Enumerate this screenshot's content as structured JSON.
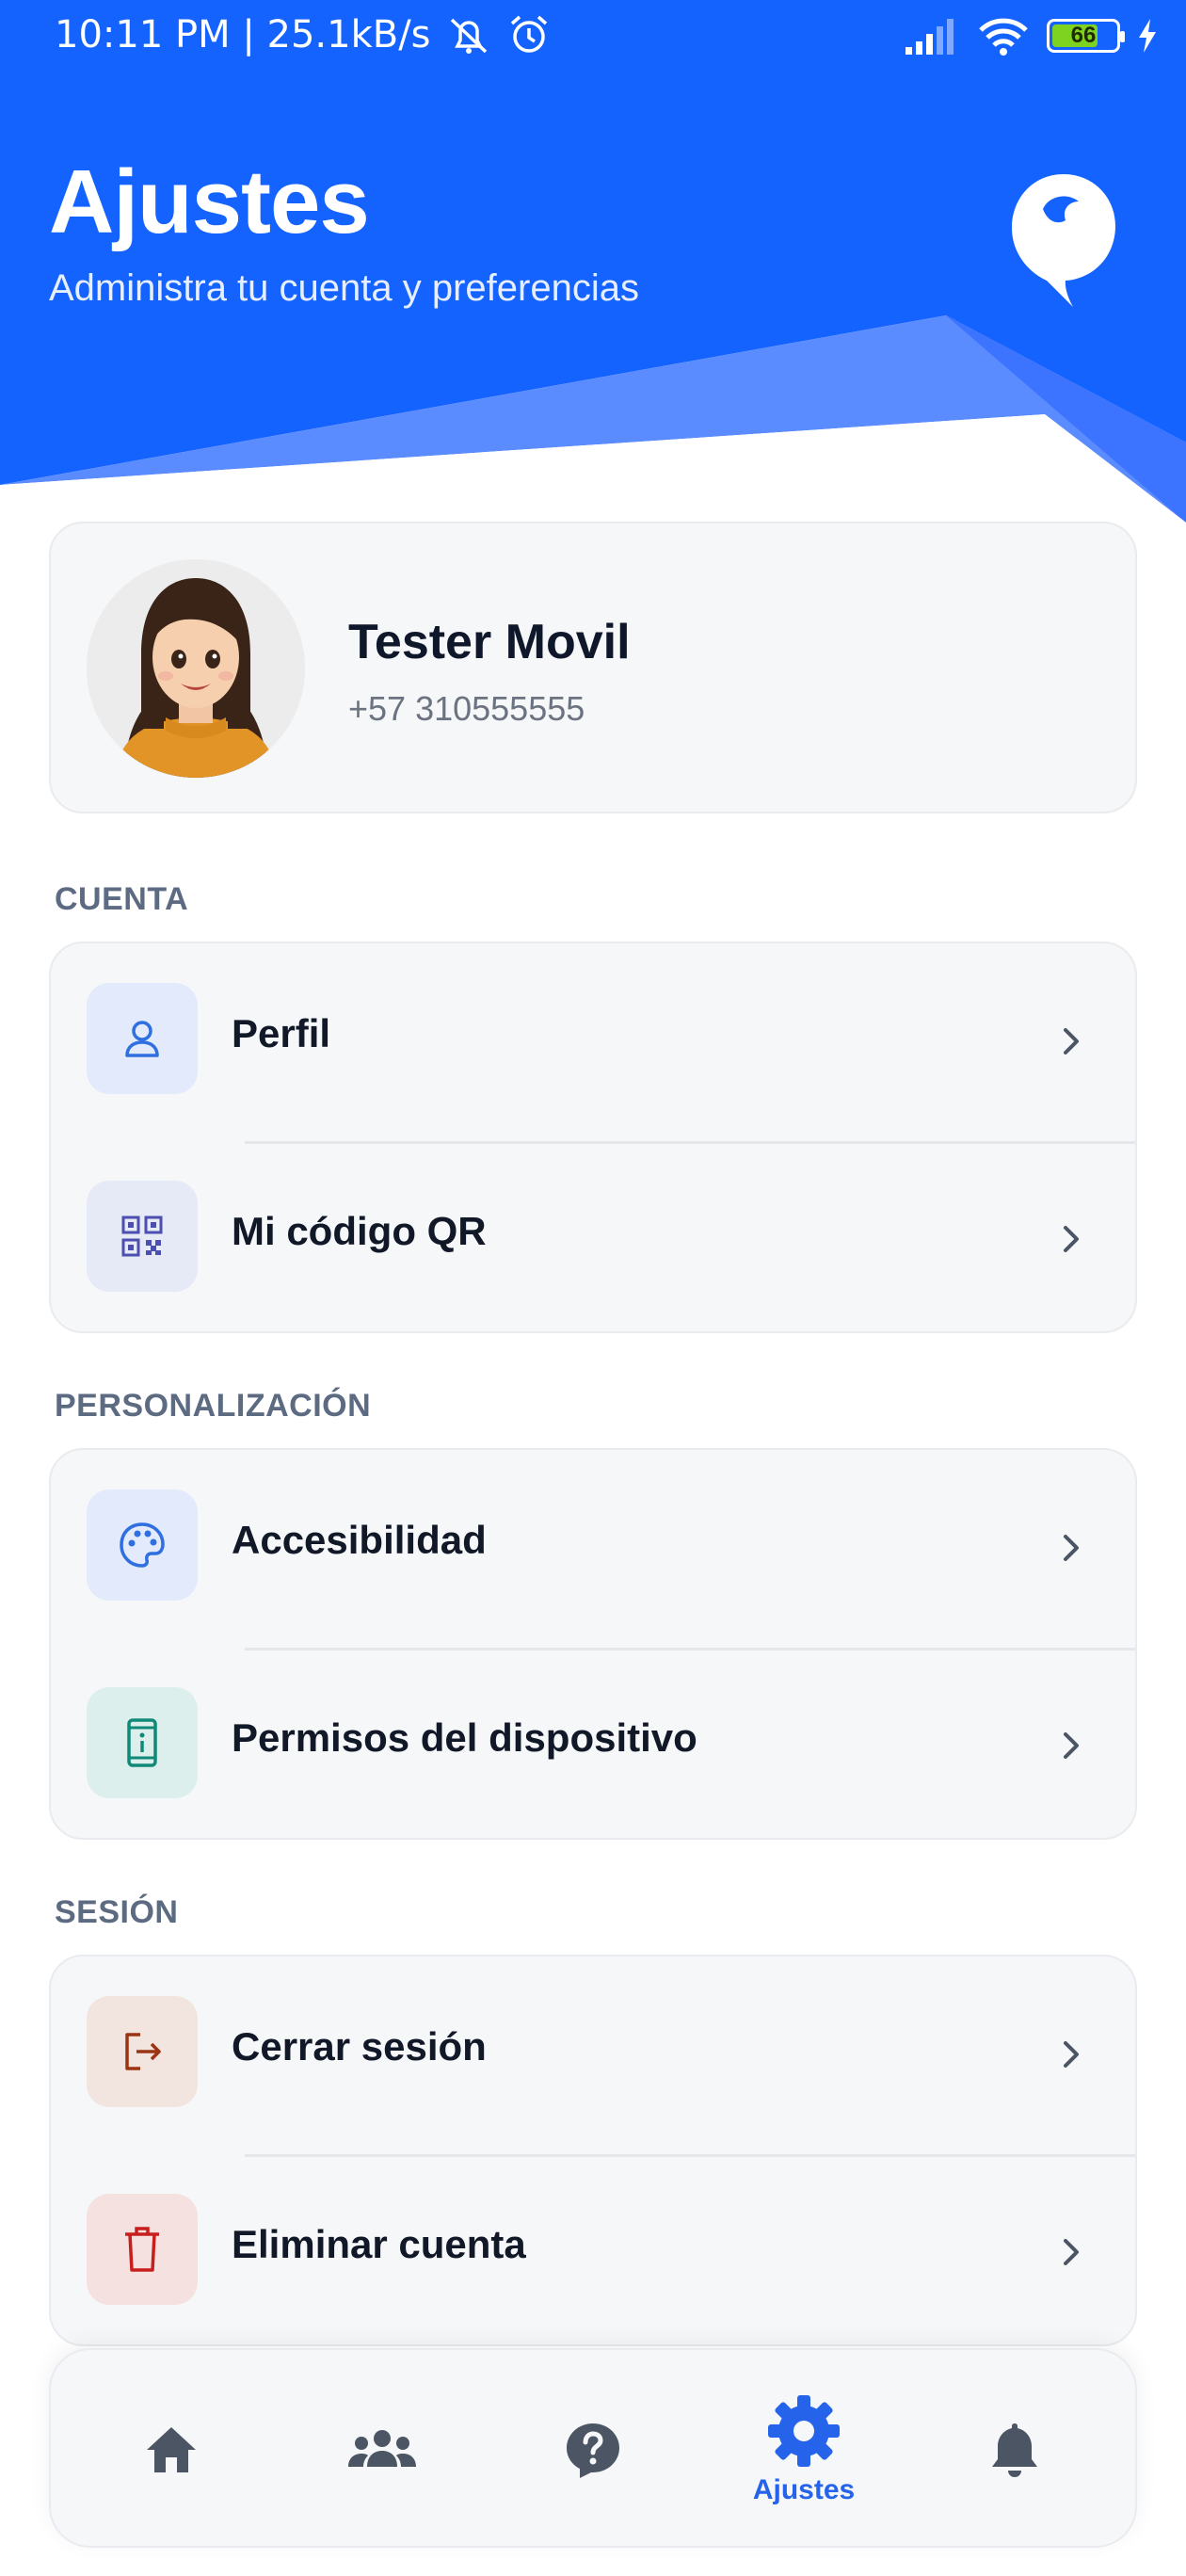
{
  "status_bar": {
    "time_speed": "10:11 PM | 25.1kB/s",
    "battery": "66"
  },
  "header": {
    "title": "Ajustes",
    "subtitle": "Administra tu cuenta y preferencias"
  },
  "profile": {
    "name": "Tester Movil",
    "phone": "+57 310555555"
  },
  "sections": {
    "cuenta": {
      "label": "CUENTA",
      "items": [
        {
          "label": "Perfil",
          "icon": "person-icon"
        },
        {
          "label": "Mi código QR",
          "icon": "qr-code-icon"
        }
      ]
    },
    "personalizacion": {
      "label": "PERSONALIZACIÓN",
      "items": [
        {
          "label": "Accesibilidad",
          "icon": "palette-icon"
        },
        {
          "label": "Permisos del dispositivo",
          "icon": "device-info-icon"
        }
      ]
    },
    "sesion": {
      "label": "SESIÓN",
      "items": [
        {
          "label": "Cerrar sesión",
          "icon": "logout-icon"
        },
        {
          "label": "Eliminar cuenta",
          "icon": "trash-icon"
        }
      ]
    }
  },
  "bottom_nav": {
    "items": [
      {
        "icon": "home-icon",
        "label": ""
      },
      {
        "icon": "people-icon",
        "label": ""
      },
      {
        "icon": "help-icon",
        "label": ""
      },
      {
        "icon": "gear-icon",
        "label": "Ajustes",
        "active": true
      },
      {
        "icon": "bell-icon",
        "label": ""
      }
    ]
  },
  "colors": {
    "primary": "#1463ff",
    "primary_light": "#5b8cff",
    "nav_inactive": "#4b5563"
  }
}
